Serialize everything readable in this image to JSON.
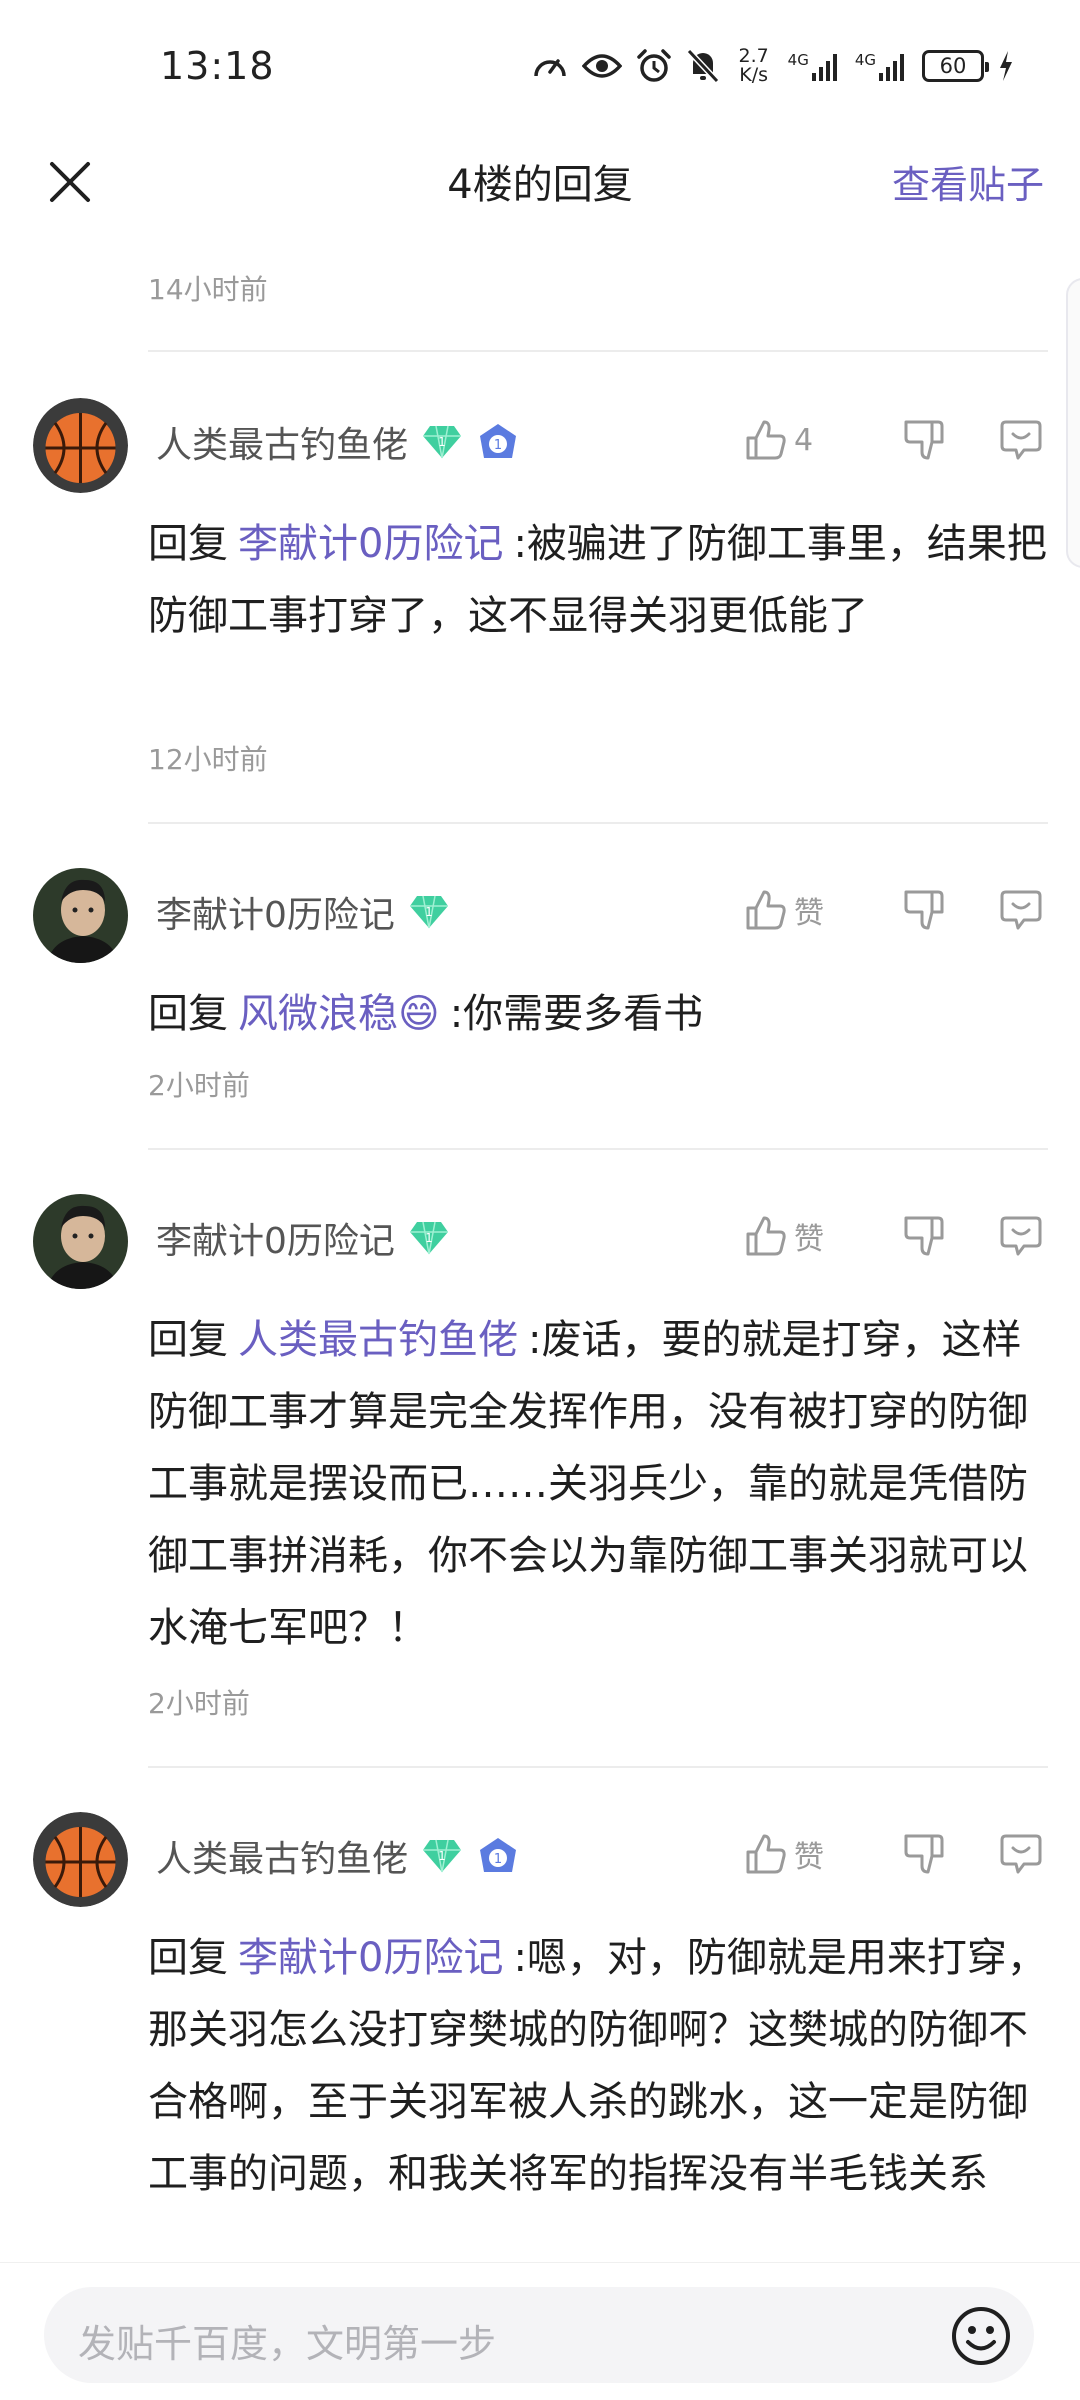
{
  "status_bar": {
    "time": "13:18",
    "net_speed_value": "2.7",
    "net_speed_unit": "K/s",
    "network_1": "4G",
    "network_2": "4G",
    "battery": "60",
    "icons": [
      "speedometer-icon",
      "eye-icon",
      "alarm-icon",
      "mute-bell-icon",
      "signal-icon",
      "signal-icon",
      "battery-icon",
      "charging-icon"
    ]
  },
  "header": {
    "title": "4楼的回复",
    "view_post": "查看贴子"
  },
  "top_time": "14小时前",
  "comments": [
    {
      "author": "人类最古钓鱼佬",
      "avatar": "basketball-avatar",
      "badges": [
        "diamond-badge",
        "level-badge"
      ],
      "level_badge_text": "1",
      "likes": "4",
      "reply_label": "回复",
      "mention": "李献计0历险记",
      "text": ":被骗进了防御工事里，结果把防御工事打穿了，这不显得关羽更低能了",
      "time": "12小时前"
    },
    {
      "author": "李献计0历险记",
      "avatar": "portrait-avatar",
      "badges": [
        "diamond-badge"
      ],
      "likes": "赞",
      "reply_label": "回复",
      "mention": "风微浪稳😄",
      "text": ":你需要多看书",
      "time": "2小时前"
    },
    {
      "author": "李献计0历险记",
      "avatar": "portrait-avatar",
      "badges": [
        "diamond-badge"
      ],
      "likes": "赞",
      "reply_label": "回复",
      "mention": "人类最古钓鱼佬",
      "text": ":废话，要的就是打穿，这样防御工事才算是完全发挥作用，没有被打穿的防御工事就是摆设而已……关羽兵少，靠的就是凭借防御工事拼消耗，你不会以为靠防御工事关羽就可以水淹七军吧？！",
      "time": "2小时前"
    },
    {
      "author": "人类最古钓鱼佬",
      "avatar": "basketball-avatar",
      "badges": [
        "diamond-badge",
        "level-badge"
      ],
      "level_badge_text": "1",
      "likes": "赞",
      "reply_label": "回复",
      "mention": "李献计0历险记",
      "text": ":嗯，对，防御就是用来打穿，那关羽怎么没打穿樊城的防御啊？这樊城的防御不合格啊，至于关羽军被人杀的跳水，这一定是防御工事的问题，和我关将军的指挥没有半毛钱关系",
      "time": ""
    }
  ],
  "input": {
    "placeholder": "发贴千百度，文明第一步"
  },
  "colors": {
    "accent": "#6a5fc1",
    "diamond": "#3fcf9f",
    "muted_text": "#9a9a9a"
  }
}
